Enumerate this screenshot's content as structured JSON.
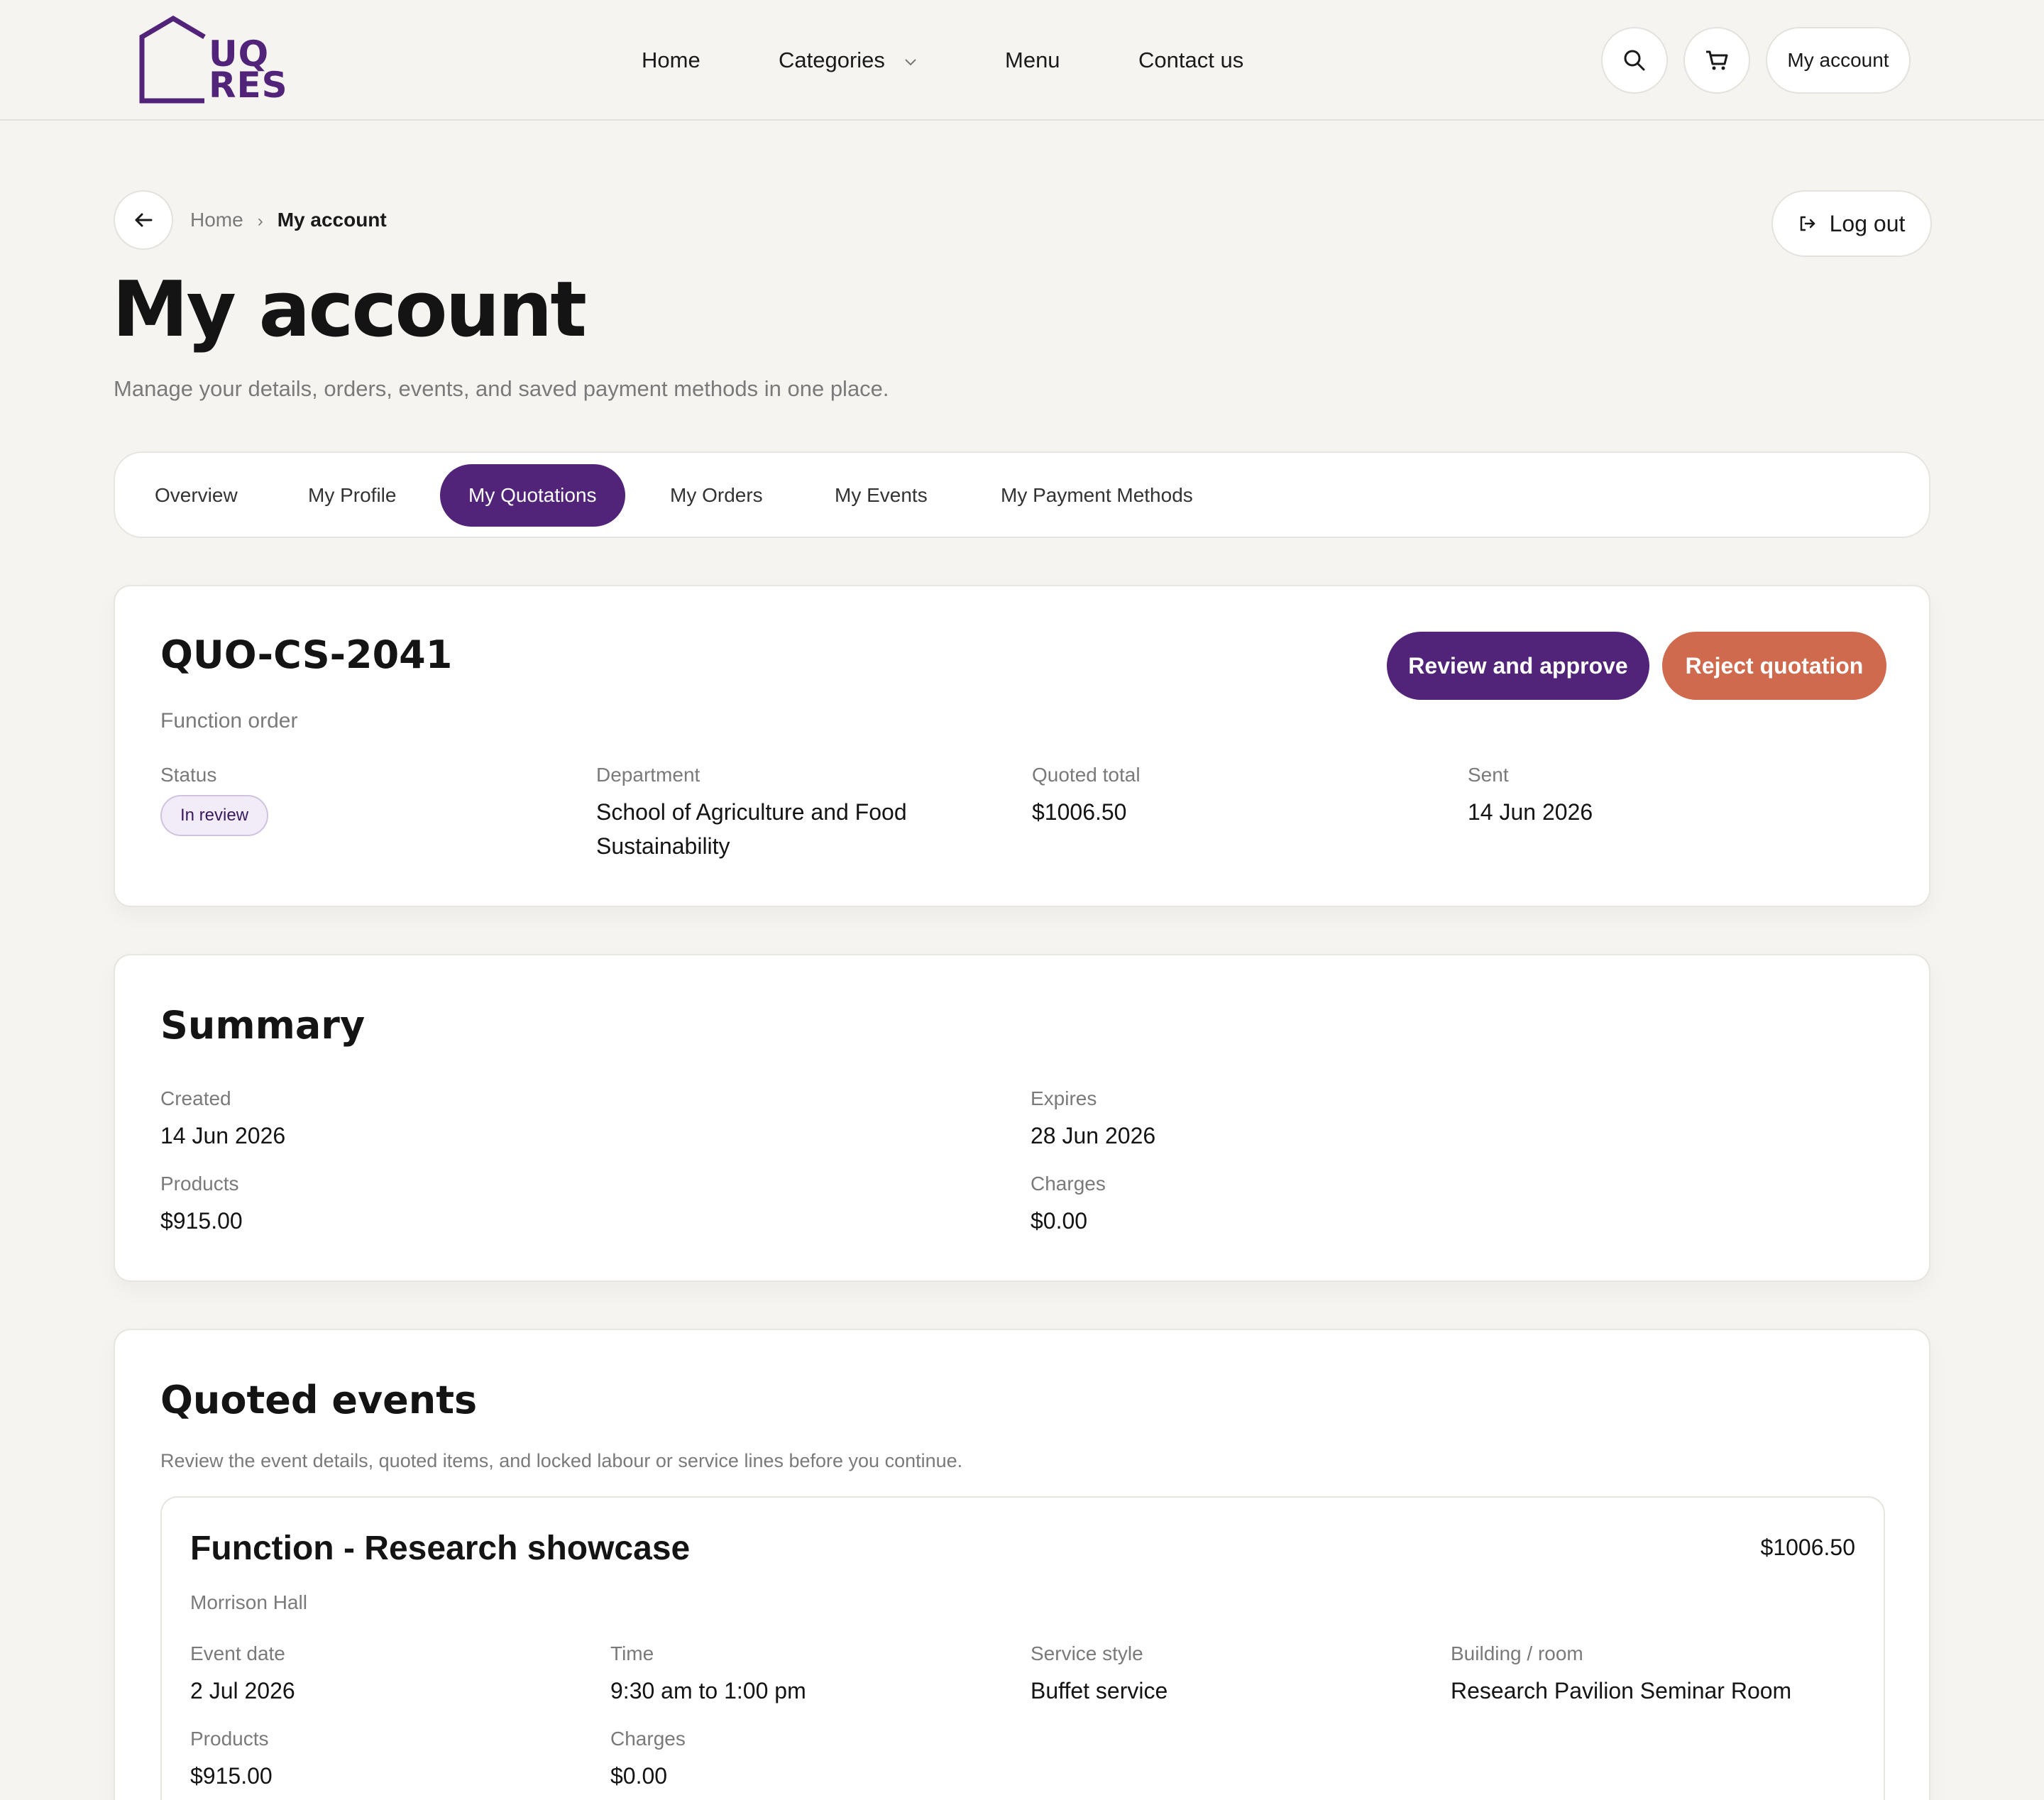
{
  "header": {
    "logo_line1": "UQ",
    "logo_line2": "RES",
    "nav": [
      {
        "label": "Home"
      },
      {
        "label": "Categories"
      },
      {
        "label": "Menu"
      },
      {
        "label": "Contact us"
      }
    ],
    "account_label": "My account"
  },
  "breadcrumb": {
    "home": "Home",
    "separator": "›",
    "current": "My account"
  },
  "logout_label": "Log out",
  "page": {
    "title": "My account",
    "subtitle": "Manage your details, orders, events, and saved payment methods in one place."
  },
  "tabs": [
    {
      "label": "Overview",
      "active": false
    },
    {
      "label": "My Profile",
      "active": false
    },
    {
      "label": "My Quotations",
      "active": true
    },
    {
      "label": "My Orders",
      "active": false
    },
    {
      "label": "My Events",
      "active": false
    },
    {
      "label": "My Payment Methods",
      "active": false
    }
  ],
  "quotation": {
    "id": "QUO-CS-2041",
    "type": "Function order",
    "approve_label": "Review and approve",
    "reject_label": "Reject quotation",
    "status_label": "Status",
    "status_value": "In review",
    "department_label": "Department",
    "department_value": "School of Agriculture and Food Sustainability",
    "total_label": "Quoted total",
    "total_value": "$1006.50",
    "sent_label": "Sent",
    "sent_value": "14 Jun 2026"
  },
  "summary": {
    "title": "Summary",
    "created_label": "Created",
    "created_value": "14 Jun 2026",
    "expires_label": "Expires",
    "expires_value": "28 Jun 2026",
    "products_label": "Products",
    "products_value": "$915.00",
    "charges_label": "Charges",
    "charges_value": "$0.00"
  },
  "quoted_events": {
    "title": "Quoted events",
    "description": "Review the event details, quoted items, and locked labour or service lines before you continue.",
    "events": [
      {
        "title": "Function - Research showcase",
        "price": "$1006.50",
        "venue": "Morrison Hall",
        "date_label": "Event date",
        "date_value": "2 Jul 2026",
        "time_label": "Time",
        "time_value": "9:30 am to 1:00 pm",
        "style_label": "Service style",
        "style_value": "Buffet service",
        "room_label": "Building / room",
        "room_value": "Research Pavilion Seminar Room",
        "products_label": "Products",
        "products_value": "$915.00",
        "charges_label": "Charges",
        "charges_value": "$0.00"
      }
    ]
  },
  "colors": {
    "brand_purple": "#51247a",
    "reject_orange": "#d06a4f",
    "background": "#f5f4f0"
  },
  "icons": [
    "house-logo-icon",
    "chevron-down-icon",
    "search-icon",
    "cart-icon",
    "arrow-left-icon",
    "logout-icon"
  ]
}
